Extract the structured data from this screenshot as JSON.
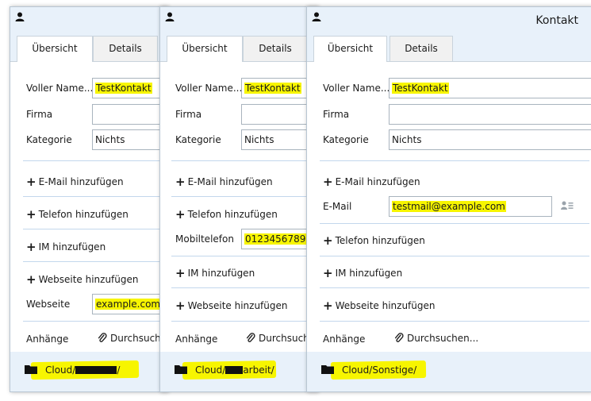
{
  "windows": [
    {
      "title": "",
      "tabs": [
        "Übersicht",
        "Details"
      ],
      "fields": {
        "full_name_label": "Voller Name...",
        "full_name_value": "TestKontakt",
        "company_label": "Firma",
        "company_value": "",
        "category_label": "Kategorie",
        "category_value": "Nichts"
      },
      "add_email": "E-Mail hinzufügen",
      "add_phone": "Telefon hinzufügen",
      "add_im": "IM hinzufügen",
      "add_website": "Webseite hinzufügen",
      "website_label": "Webseite",
      "website_value": "example.com",
      "attachments_label": "Anhänge",
      "browse_label": "Durchsuchen...",
      "path_prefix": "Cloud/",
      "path_suffix": "/"
    },
    {
      "title": "",
      "tabs": [
        "Übersicht",
        "Details"
      ],
      "fields": {
        "full_name_label": "Voller Name...",
        "full_name_value": "TestKontakt",
        "company_label": "Firma",
        "company_value": "",
        "category_label": "Kategorie",
        "category_value": "Nichts"
      },
      "add_email": "E-Mail hinzufügen",
      "add_phone": "Telefon hinzufügen",
      "mobile_label": "Mobiltelefon",
      "mobile_value": "0123456789",
      "add_im": "IM hinzufügen",
      "add_website": "Webseite hinzufügen",
      "attachments_label": "Anhänge",
      "browse_label": "Durchsuchen...",
      "path_prefix": "Cloud/",
      "path_suffix": "arbeit/"
    },
    {
      "title": "Kontakt",
      "tabs": [
        "Übersicht",
        "Details"
      ],
      "fields": {
        "full_name_label": "Voller Name...",
        "full_name_value": "TestKontakt",
        "company_label": "Firma",
        "company_value": "",
        "category_label": "Kategorie",
        "category_value": "Nichts"
      },
      "add_email": "E-Mail hinzufügen",
      "email_label": "E-Mail",
      "email_value": "testmail@example.com",
      "add_phone": "Telefon hinzufügen",
      "add_im": "IM hinzufügen",
      "add_website": "Webseite hinzufügen",
      "attachments_label": "Anhänge",
      "browse_label": "Durchsuchen...",
      "path": "Cloud/Sonstige/"
    }
  ],
  "colors": {
    "highlight": "#f7f500",
    "titlebar": "#e8f1fa",
    "separator": "#c3d7ec"
  }
}
